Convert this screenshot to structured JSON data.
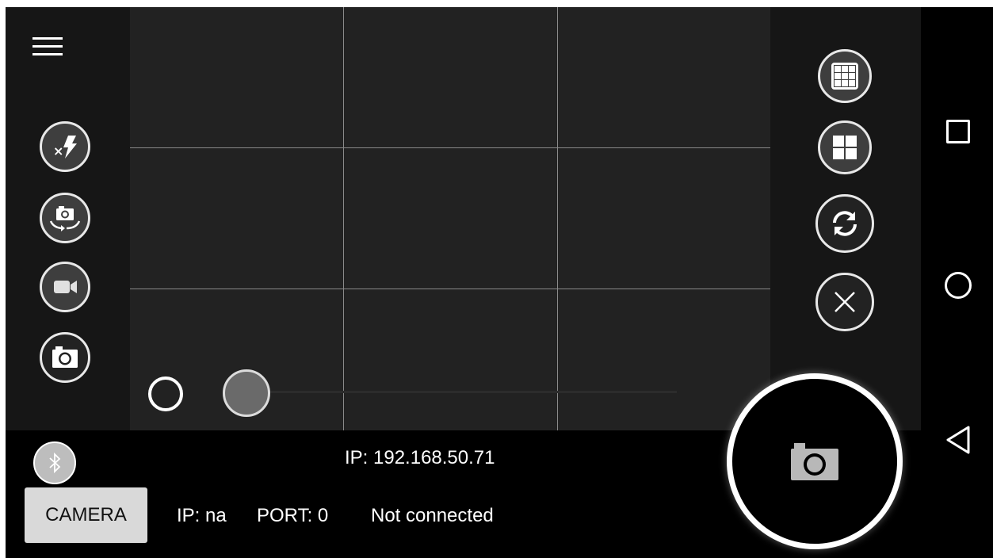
{
  "left_toolbar": {
    "menu_icon": "hamburger-menu-icon",
    "buttons": [
      "flash-off-icon",
      "switch-camera-icon",
      "video-camera-icon",
      "photo-camera-icon"
    ]
  },
  "viewfinder": {
    "grid": "3x3",
    "mode_selector": {
      "icons": [
        "radio-circle-icon",
        "slider-knob-icon"
      ]
    }
  },
  "right_toolbar": {
    "buttons": [
      "grid-3x3-icon",
      "grid-2x2-icon",
      "refresh-icon",
      "close-icon"
    ]
  },
  "status": {
    "bluetooth_icon": "bluetooth-icon",
    "ip_top": "IP: 192.168.50.71",
    "camera_label": "CAMERA",
    "ip": "IP: na",
    "port": "PORT: 0",
    "connection": "Not connected"
  },
  "shutter": {
    "icon": "camera-icon"
  },
  "nav_bar": {
    "icons": [
      "recent-apps-icon",
      "home-icon",
      "back-icon"
    ]
  },
  "colors": {
    "background": "#000000",
    "panel": "#161616",
    "viewfinder": "#222222",
    "button_fill": "#3e3e3e",
    "button_border": "#e8e8e8",
    "camera_button": "#d9d9d9"
  }
}
